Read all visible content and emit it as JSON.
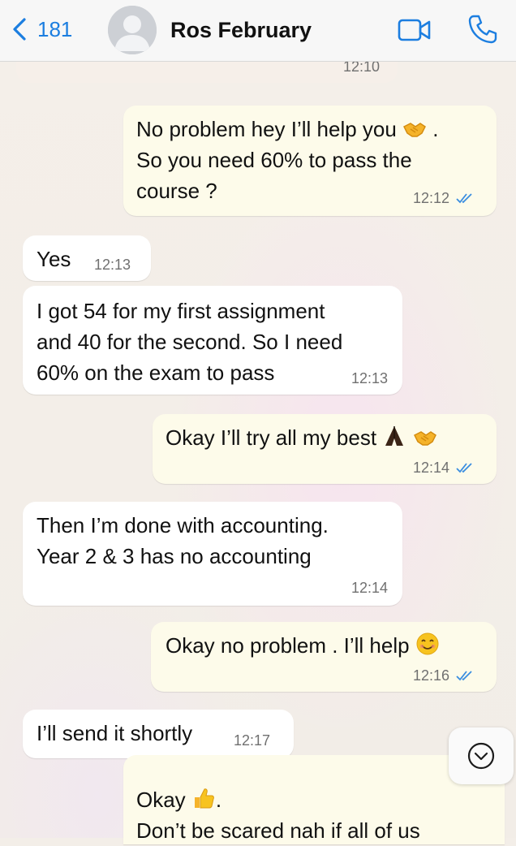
{
  "header": {
    "back_count": "181",
    "contact_name": "Ros February"
  },
  "messages": [
    {
      "side": "out",
      "text": "",
      "time": "12:10"
    },
    {
      "side": "out",
      "text": "No problem hey I’ll help you",
      "text_tail": " .",
      "line2": "So you need 60% to pass the",
      "line3": "course ?",
      "time": "12:12"
    },
    {
      "side": "in",
      "text": "Yes",
      "time": "12:13"
    },
    {
      "side": "in",
      "line1": "I got 54 for my first assignment",
      "line2": "and 40 for the second. So I need",
      "line3": "60% on the exam to pass",
      "time": "12:13"
    },
    {
      "side": "out",
      "text": "Okay I’ll try all my best",
      "time": "12:14"
    },
    {
      "side": "in",
      "line1": "Then I’m done with accounting.",
      "line2": "Year 2 & 3 has no accounting",
      "time": "12:14"
    },
    {
      "side": "out",
      "text": "Okay no problem . I’ll help",
      "time": "12:16"
    },
    {
      "side": "in",
      "text": "I’ll send it shortly",
      "time": "12:17"
    },
    {
      "side": "out",
      "line1": "Okay",
      "line1_tail": ".",
      "line2": "Don’t be scared nah if all of us"
    }
  ],
  "colors": {
    "accent": "#1c7ee0",
    "outgoing_bubble": "#fdfbea",
    "incoming_bubble": "#ffffff",
    "read_ticks": "#3a8de0"
  },
  "icons": [
    "back-chevron-icon",
    "avatar-icon",
    "video-call-icon",
    "phone-icon",
    "read-ticks-icon",
    "handshake-emoji",
    "praying-hands-emoji",
    "smiling-face-emoji",
    "thumbs-up-emoji",
    "scroll-down-icon"
  ]
}
